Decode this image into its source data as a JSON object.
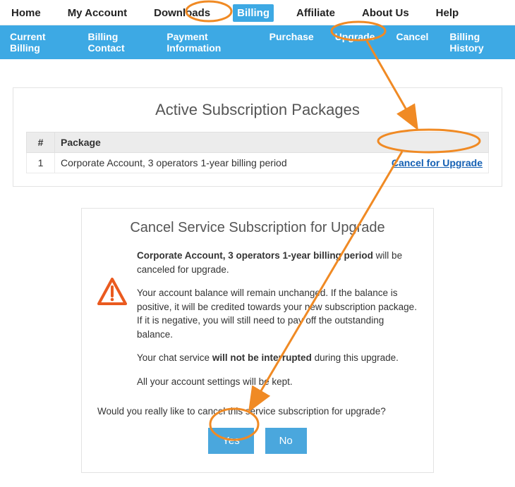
{
  "topnav": {
    "items": [
      "Home",
      "My Account",
      "Downloads",
      "Billing",
      "Affiliate",
      "About Us",
      "Help"
    ],
    "active_index": 3
  },
  "subnav": {
    "items": [
      "Current Billing",
      "Billing Contact",
      "Payment Information",
      "Purchase",
      "Upgrade",
      "Cancel",
      "Billing History"
    ],
    "highlight_index": 4
  },
  "panel": {
    "title": "Active Subscription Packages",
    "columns": {
      "num": "#",
      "package": "Package"
    },
    "rows": [
      {
        "num": "1",
        "package": "Corporate Account, 3 operators 1-year billing period",
        "action": "Cancel for Upgrade"
      }
    ]
  },
  "dialog": {
    "title": "Cancel Service Subscription for Upgrade",
    "package_name": "Corporate Account, 3 operators 1-year billing period",
    "line1_suffix": " will be canceled for upgrade.",
    "balance_text": "Your account balance will remain unchanged. If the balance is positive, it will be credited towards your new subscription package. If it is negative, you will still need to pay off the outstanding balance.",
    "chat_prefix": "Your chat service ",
    "chat_bold": "will not be interrupted",
    "chat_suffix": " during this upgrade.",
    "settings_text": "All your account settings will be kept.",
    "confirm_text": "Would you really like to cancel this service subscription for upgrade?",
    "yes": "Yes",
    "no": "No"
  },
  "colors": {
    "accent": "#3da9e4",
    "highlight": "#f08a24",
    "link": "#1560b3"
  }
}
